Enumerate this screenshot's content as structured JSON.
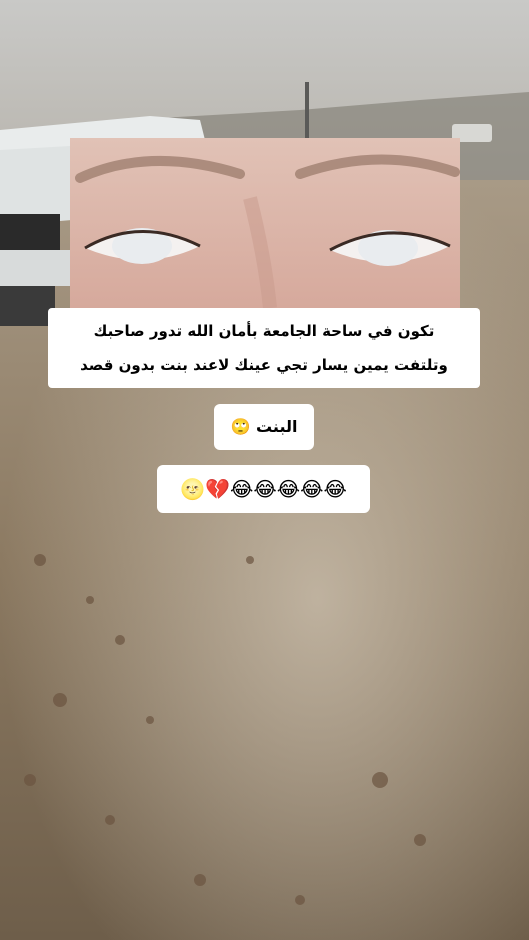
{
  "captions": {
    "line1": "تكون في ساحة الجامعة بأمان الله تدور صاحبك",
    "line2": "وتلتفت يمين يسار تجي عينك لاعند بنت بدون قصد",
    "girl": "البنت 🙄",
    "emojis": "😂😂😂😂😂💔🌝"
  },
  "colors": {
    "caption_bg": "#ffffff",
    "caption_text": "#000000",
    "dust": "#9a8a74"
  }
}
